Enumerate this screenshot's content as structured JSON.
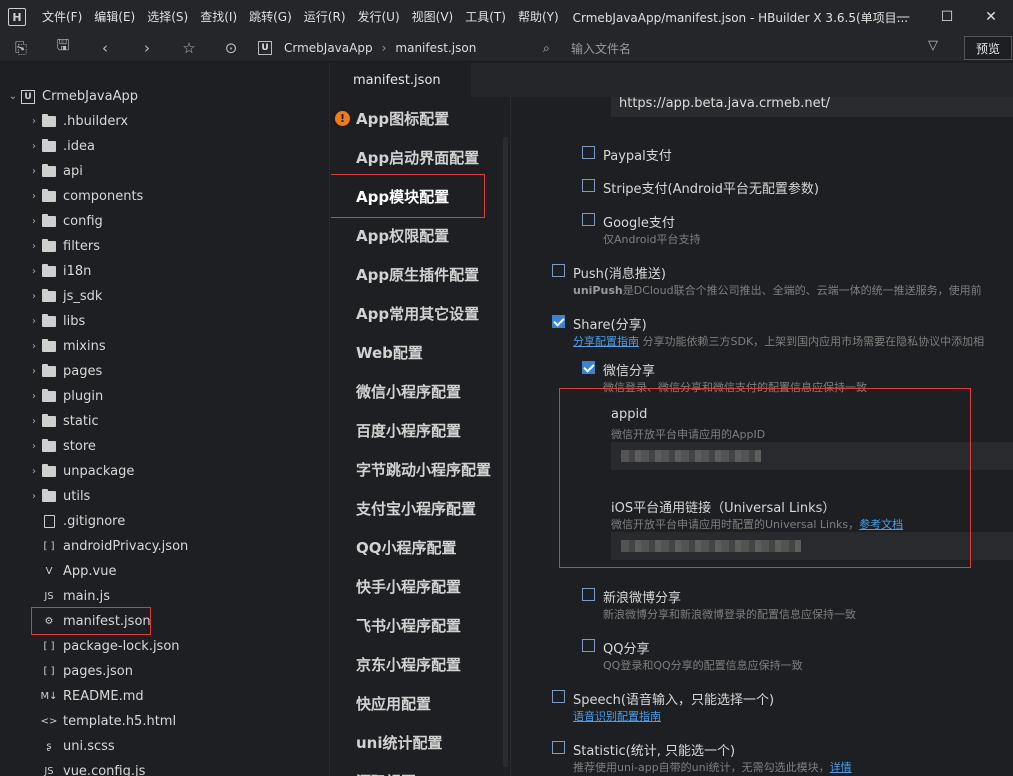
{
  "menubar": {
    "logo": "H",
    "items": [
      "文件(F)",
      "编辑(E)",
      "选择(S)",
      "查找(I)",
      "跳转(G)",
      "运行(R)",
      "发行(U)",
      "视图(V)",
      "工具(T)",
      "帮助(Y)"
    ],
    "title": "CrmebJavaApp/manifest.json - HBuilder X 3.6.5(单项目..."
  },
  "toolbar": {
    "breadcrumb_project": "CrmebJavaApp",
    "breadcrumb_file": "manifest.json",
    "file_search_placeholder": "输入文件名",
    "preview_label": "预览"
  },
  "sidebar": {
    "root": "CrmebJavaApp",
    "folders": [
      ".hbuilderx",
      ".idea",
      "api",
      "components",
      "config",
      "filters",
      "i18n",
      "js_sdk",
      "libs",
      "mixins",
      "pages",
      "plugin",
      "static",
      "store",
      "unpackage",
      "utils"
    ],
    "files": [
      {
        "name": ".gitignore",
        "icon": "file-icon",
        "glyph": ""
      },
      {
        "name": "androidPrivacy.json",
        "icon": "json-icon",
        "glyph": "[ ]"
      },
      {
        "name": "App.vue",
        "icon": "vue-icon",
        "glyph": "V"
      },
      {
        "name": "main.js",
        "icon": "js-icon",
        "glyph": "JS"
      },
      {
        "name": "manifest.json",
        "icon": "manifest-icon",
        "glyph": "⚙"
      },
      {
        "name": "package-lock.json",
        "icon": "json-icon",
        "glyph": "[ ]"
      },
      {
        "name": "pages.json",
        "icon": "json-icon",
        "glyph": "[ ]"
      },
      {
        "name": "README.md",
        "icon": "markdown-icon",
        "glyph": "M↓"
      },
      {
        "name": "template.h5.html",
        "icon": "html-icon",
        "glyph": "<>"
      },
      {
        "name": "uni.scss",
        "icon": "scss-icon",
        "glyph": "ʂ"
      },
      {
        "name": "vue.config.js",
        "icon": "js-icon",
        "glyph": "JS"
      }
    ],
    "selected": "manifest.json"
  },
  "editor": {
    "tab": "manifest.json"
  },
  "confnav": {
    "items": [
      "App图标配置",
      "App启动界面配置",
      "App模块配置",
      "App权限配置",
      "App原生插件配置",
      "App常用其它设置",
      "Web配置",
      "微信小程序配置",
      "百度小程序配置",
      "字节跳动小程序配置",
      "支付宝小程序配置",
      "QQ小程序配置",
      "快手小程序配置",
      "飞书小程序配置",
      "京东小程序配置",
      "快应用配置",
      "uni统计配置",
      "源码视图"
    ],
    "active": "App模块配置",
    "warning_item": "App图标配置"
  },
  "content": {
    "url_value": "https://app.beta.java.crmeb.net/",
    "paypal": {
      "label": "Paypal支付",
      "checked": false
    },
    "stripe": {
      "label": "Stripe支付(Android平台无配置参数)",
      "checked": false
    },
    "google": {
      "label": "Google支付",
      "desc": "仅Android平台支持",
      "checked": false
    },
    "push": {
      "label": "Push(消息推送)",
      "desc_bold": "uniPush",
      "desc": "是DCloud联合个推公司推出、全端的、云端一体的统一推送服务，使用前",
      "checked": false
    },
    "share": {
      "label": "Share(分享)",
      "link": "分享配置指南",
      "desc": " 分享功能依赖三方SDK，上架到国内应用市场需要在隐私协议中添加相",
      "checked": true
    },
    "wechat_share": {
      "label": "微信分享",
      "desc": "微信登录、微信分享和微信支付的配置信息应保持一致",
      "checked": true
    },
    "appid": {
      "label": "appid",
      "desc": "微信开放平台申请应用的AppID"
    },
    "ulinks": {
      "label": "iOS平台通用链接（Universal Links）",
      "desc": "微信开放平台申请应用时配置的Universal Links，",
      "link": "参考文档"
    },
    "weibo_share": {
      "label": "新浪微博分享",
      "desc": "新浪微博分享和新浪微博登录的配置信息应保持一致",
      "checked": false
    },
    "qq_share": {
      "label": "QQ分享",
      "desc": "QQ登录和QQ分享的配置信息应保持一致",
      "checked": false
    },
    "speech": {
      "label": "Speech(语音输入，只能选择一个)",
      "link": "语音识别配置指南",
      "checked": false
    },
    "statistic": {
      "label": "Statistic(统计, 只能选一个)",
      "desc": "推荐使用uni-app自带的uni统计，无需勾选此模块，",
      "link": "详情",
      "checked": false
    }
  },
  "colors": {
    "accent": "#3b83d0",
    "highlight_border": "#e03a3a",
    "warning": "#f07b1a",
    "link": "#4a9eea"
  }
}
